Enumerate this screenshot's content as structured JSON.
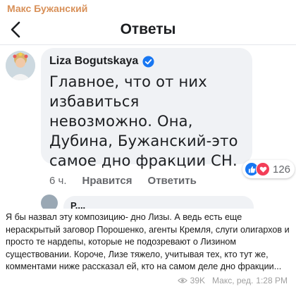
{
  "channel": {
    "name": "Макс Бужанский"
  },
  "screenshot": {
    "nav": {
      "title": "Ответы",
      "back_icon": "chevron-left-icon"
    },
    "comment": {
      "author": "Liza Bogutskaya",
      "verified_icon": "verified-badge-icon",
      "text": "Главное, что от них избавиться невозможно. Она, Дубина, Бужанский-это самое дно фракции СН.",
      "reactions": {
        "icons": [
          "like-icon",
          "love-icon"
        ],
        "count": "126"
      },
      "time": "6 ч.",
      "like_label": "Нравится",
      "reply_label": "Ответить"
    },
    "next_reply": {
      "author": "Р...."
    }
  },
  "post": {
    "text": "Я бы назвал эту композицию- дно Лизы. А ведь есть еще нераскрытый заговор Порошенко, агенты Кремля, слуги олигархов и просто те нардепы, которые не подозревают о Лизином существовании. Короче, Лизе тяжело, учитывая тех, кто тут же, комментами ниже рассказал ей, кто на самом деле дно фракции...",
    "views": "39K",
    "signature": "Макс, ред.",
    "time": "1:28 PM"
  },
  "colors": {
    "channel_name": "#d89058",
    "bubble": "#f0f2f5",
    "like": "#1877f2",
    "love": "#f33e58",
    "verified": "#1877f2"
  }
}
